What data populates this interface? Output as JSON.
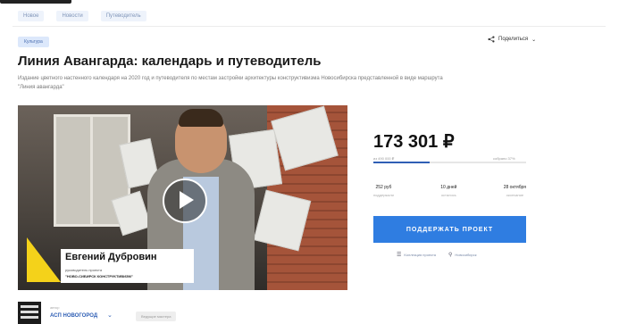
{
  "breadcrumb": [
    "Новое",
    "Новости",
    "Путеводитель"
  ],
  "category": "Культура",
  "share_label": "Поделиться",
  "title": "Линия Авангарда: календарь и путеводитель",
  "description": "Издание цветного настенного календаря на 2020 год и путеводителя по местам застройки архитектуры конструктивизма Новосибирска представленной в виде маршрута \"Линия авангарда\"",
  "video": {
    "speaker_name": "Евгений Дубровин",
    "speaker_role": "руководитель проекта",
    "speaker_org": "\"НОВО-СИБИРСК КОНСТРУКТИВИЗМ\""
  },
  "funding": {
    "amount": "173 301 ₽",
    "goal_text": "из 490 000 ₽",
    "percent_text": "собрано 37%",
    "progress_fraction": 0.37,
    "stats": [
      {
        "value": "252 руб",
        "caption": "поддержали"
      },
      {
        "value": "10 дней",
        "caption": "осталось"
      },
      {
        "value": "28 октября",
        "caption": "окончание"
      }
    ],
    "support_button": "ПОДДЕРЖАТЬ ПРОЕКТ",
    "link_rewards": "Коллекция проекта",
    "link_location": "Новосибирск"
  },
  "author": {
    "caption": "автор",
    "name": "АСП НОВОГОРОД",
    "tag": "Ведущие мастера"
  },
  "colors": {
    "accent": "#2f7de1",
    "progress": "#2f5fb5",
    "badge_bg": "#dce8fb",
    "lower_third_yellow": "#f4d21a"
  }
}
